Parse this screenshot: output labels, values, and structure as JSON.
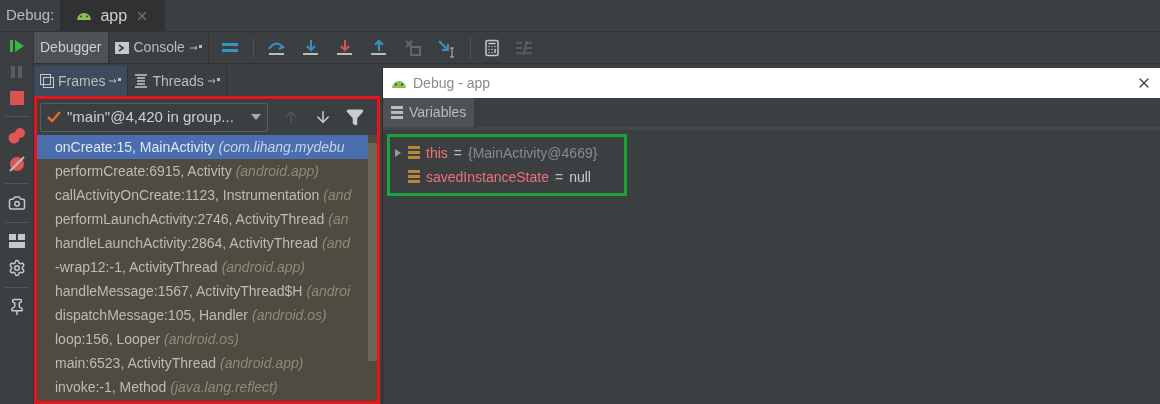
{
  "debug_bar": {
    "label": "Debug:",
    "tabs": [
      {
        "label": "app",
        "selected": true
      }
    ]
  },
  "tool_tabs": [
    {
      "label": "Debugger",
      "selected": true
    },
    {
      "label": "Console",
      "selected": false
    }
  ],
  "frames_panel": {
    "tabs": [
      {
        "label": "Frames",
        "selected": true
      },
      {
        "label": "Threads",
        "selected": false
      }
    ],
    "thread": "\"main\"@4,420 in group...",
    "frames": [
      {
        "method": "onCreate:15, MainActivity",
        "package": "(com.lihang.mydebu",
        "selected": true
      },
      {
        "method": "performCreate:6915, Activity",
        "package": "(android.app)",
        "selected": false
      },
      {
        "method": "callActivityOnCreate:1123, Instrumentation",
        "package": "(and",
        "selected": false
      },
      {
        "method": "performLaunchActivity:2746, ActivityThread",
        "package": "(an",
        "selected": false
      },
      {
        "method": "handleLaunchActivity:2864, ActivityThread",
        "package": "(and",
        "selected": false
      },
      {
        "method": "-wrap12:-1, ActivityThread",
        "package": "(android.app)",
        "selected": false
      },
      {
        "method": "handleMessage:1567, ActivityThread$H",
        "package": "(androi",
        "selected": false
      },
      {
        "method": "dispatchMessage:105, Handler",
        "package": "(android.os)",
        "selected": false
      },
      {
        "method": "loop:156, Looper",
        "package": "(android.os)",
        "selected": false
      },
      {
        "method": "main:6523, ActivityThread",
        "package": "(android.app)",
        "selected": false
      },
      {
        "method": "invoke:-1, Method",
        "package": "(java.lang.reflect)",
        "selected": false
      }
    ],
    "color": "#e8141c"
  },
  "popup": {
    "title": "Debug - app",
    "tab": "Variables",
    "variables": [
      {
        "name": "this",
        "separator": "=",
        "value": "{MainActivity@4669}",
        "kind": "object",
        "expandable": true
      },
      {
        "name": "savedInstanceState",
        "separator": "=",
        "value": "null",
        "kind": "null",
        "expandable": false
      }
    ],
    "color": "#1aa33a"
  }
}
